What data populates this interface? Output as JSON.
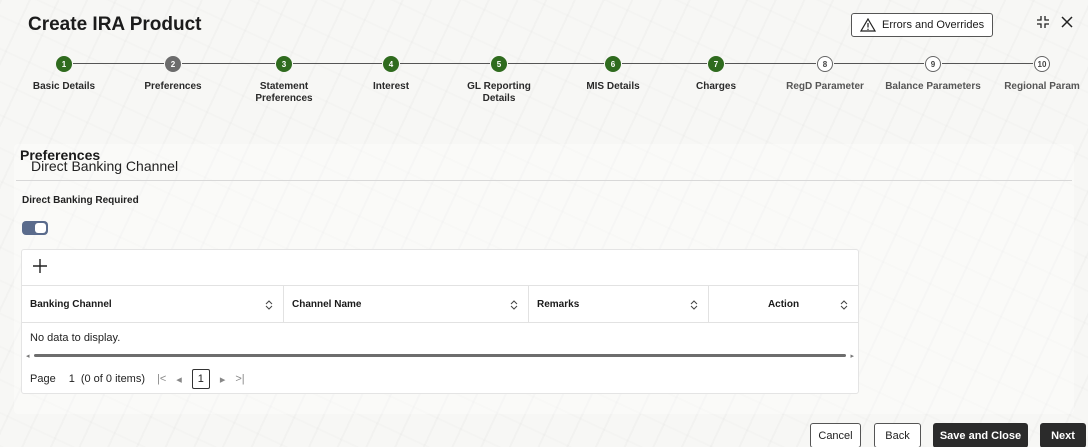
{
  "header": {
    "title": "Create IRA Product",
    "errors_button": "Errors and Overrides",
    "icons": [
      "warning-icon",
      "collapse-icon",
      "close-icon"
    ]
  },
  "stepper": {
    "steps": [
      {
        "num": "1",
        "label": "Basic Details",
        "state": "done"
      },
      {
        "num": "2",
        "label": "Preferences",
        "state": "current"
      },
      {
        "num": "3",
        "label": "Statement\nPreferences",
        "state": "done"
      },
      {
        "num": "4",
        "label": "Interest",
        "state": "done"
      },
      {
        "num": "5",
        "label": "GL Reporting\nDetails",
        "state": "done"
      },
      {
        "num": "6",
        "label": "MIS Details",
        "state": "done"
      },
      {
        "num": "7",
        "label": "Charges",
        "state": "done"
      },
      {
        "num": "8",
        "label": "RegD Parameter",
        "state": "future"
      },
      {
        "num": "9",
        "label": "Balance Parameters",
        "state": "future"
      },
      {
        "num": "10",
        "label": "Regional Param",
        "state": "future"
      }
    ]
  },
  "page": {
    "section_title": "Preferences",
    "sub_heading": "Direct Banking Channel",
    "field_label": "Direct Banking Required",
    "toggle_on": true
  },
  "grid": {
    "columns": [
      "Banking Channel",
      "Channel Name",
      "Remarks",
      "Action"
    ],
    "empty_text": "No data to display.",
    "pager": {
      "label": "Page",
      "page": "1",
      "count": "(0 of 0 items)",
      "current": "1"
    }
  },
  "footer": {
    "cancel": "Cancel",
    "back": "Back",
    "save_close": "Save and Close",
    "next": "Next"
  },
  "colors": {
    "done_step": "#2f6b1e",
    "current_step": "#6c6c6c",
    "toggle": "#5a6b8c",
    "dark_button": "#2b2b2b"
  }
}
